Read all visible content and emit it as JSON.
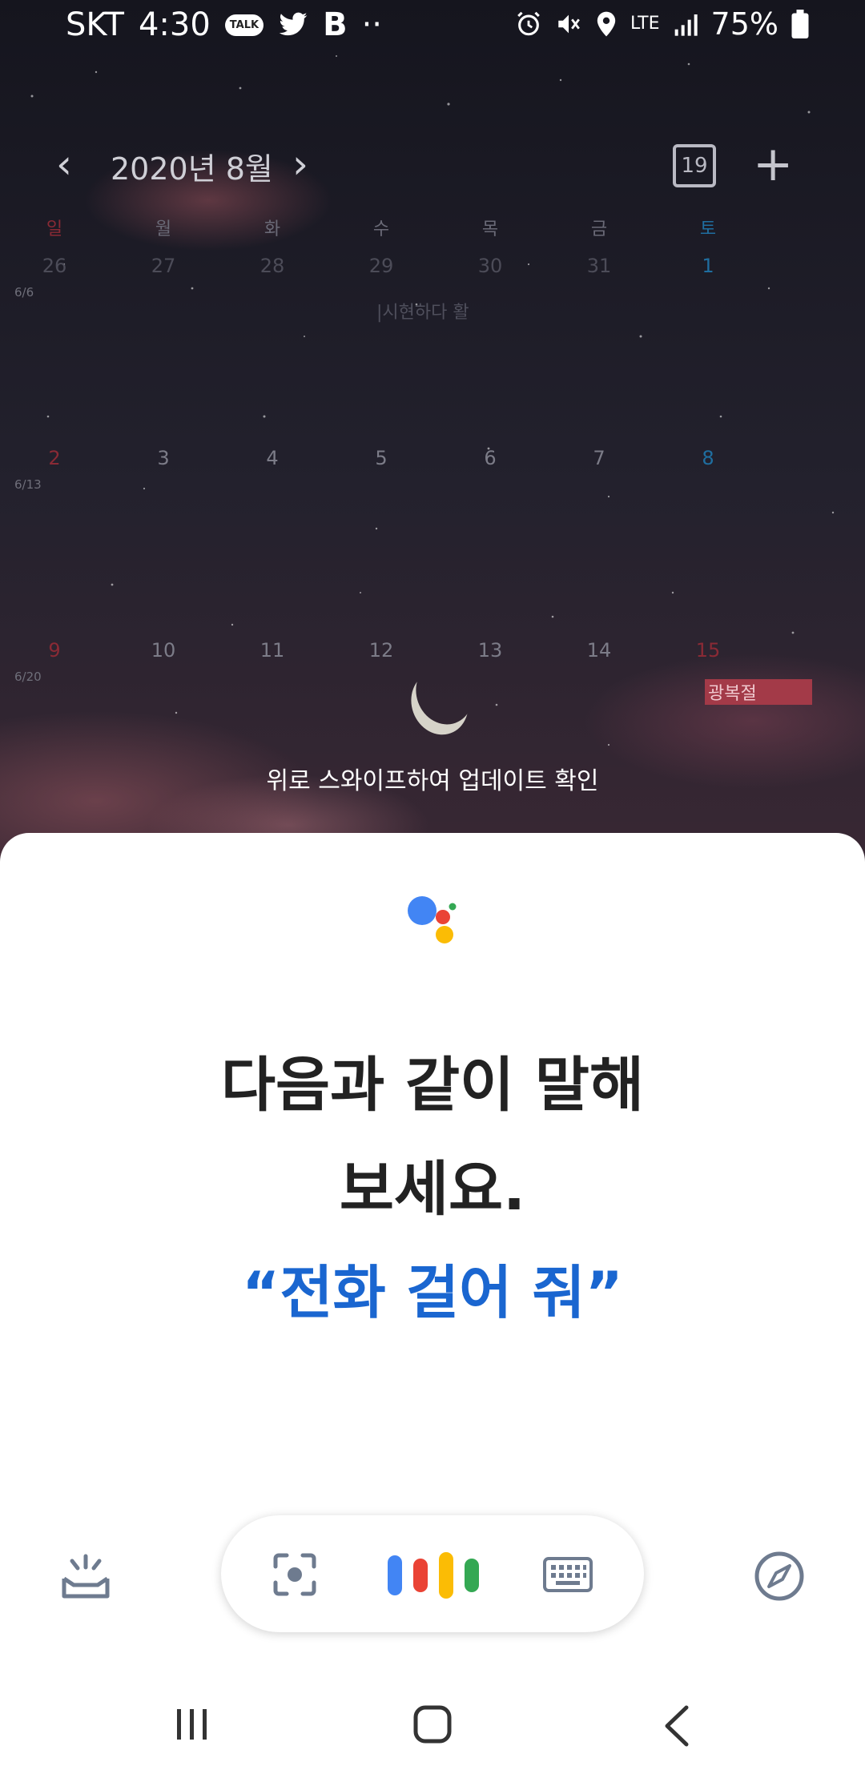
{
  "status_bar": {
    "carrier": "SKT",
    "time": "4:30",
    "talk_label": "TALK",
    "b_label": "B",
    "more": "··",
    "network": "LTE",
    "battery": "75%"
  },
  "calendar": {
    "month_title": "2020년 8월",
    "today_badge": "19",
    "weekdays": [
      "일",
      "월",
      "화",
      "수",
      "목",
      "금",
      "토"
    ],
    "weeks": [
      {
        "days": [
          "26",
          "27",
          "28",
          "29",
          "30",
          "31",
          "1"
        ],
        "sun_sub": "6/6"
      },
      {
        "days": [
          "2",
          "3",
          "4",
          "5",
          "6",
          "7",
          "8"
        ],
        "sun_sub": "6/13"
      },
      {
        "days": [
          "9",
          "10",
          "11",
          "12",
          "13",
          "14",
          "15"
        ],
        "sun_sub": "6/20"
      }
    ],
    "faint_event": "|시현하다 활",
    "holiday": "광복절"
  },
  "swipe_hint": "위로 스와이프하여 업데이트 확인",
  "assistant": {
    "prompt_line1": "다음과 같이 말해",
    "prompt_line2": "보세요.",
    "suggestion": "“전화 걸어 줘”"
  },
  "icons": {
    "updates": "snapshot-icon",
    "lens": "lens-icon",
    "mic": "mic-bars-icon",
    "keyboard": "keyboard-icon",
    "explore": "compass-icon"
  },
  "colors": {
    "google_blue": "#4285F4",
    "google_red": "#EA4335",
    "google_yellow": "#FBBC05",
    "google_green": "#34A853",
    "suggestion_blue": "#1a66d0"
  }
}
